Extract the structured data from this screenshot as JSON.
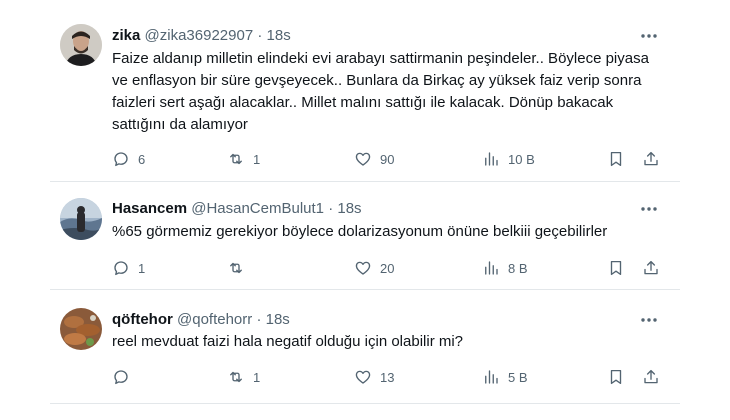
{
  "tweets": [
    {
      "display_name": "zika",
      "handle": "@zika36922907",
      "separator": "·",
      "time": "18s",
      "text": "Faize aldanıp milletin elindeki evi arabayı sattirmanin peşindeler.. Böylece piyasa ve enflasyon bir süre gevşeyecek.. Bunlara da Birkaç ay yüksek faiz verip sonra faizleri sert aşağı alacaklar.. Millet malını sattığı ile kalacak. Dönüp bakacak sattığını da alamıyor",
      "replies": "6",
      "retweets": "1",
      "likes": "90",
      "views": "10 B",
      "avatar_icon": "user-photo-avatar"
    },
    {
      "display_name": "Hasancem",
      "handle": "@HasanCemBulut1",
      "separator": "·",
      "time": "18s",
      "text": "%65 görmemiz gerekiyor böylece dolarizasyonum önüne belkiii geçebilirler",
      "replies": "1",
      "retweets": "",
      "likes": "20",
      "views": "8 B",
      "avatar_icon": "landscape-photo-avatar"
    },
    {
      "display_name": "qöftehor",
      "handle": "@qoftehorr",
      "separator": "·",
      "time": "18s",
      "text": "reel mevduat faizi hala negatif olduğu için olabilir mi?",
      "replies": "",
      "retweets": "1",
      "likes": "13",
      "views": "5 B",
      "avatar_icon": "food-photo-avatar"
    }
  ],
  "icons": {
    "reply": "reply-icon",
    "retweet": "retweet-icon",
    "like": "heart-icon",
    "views": "views-chart-icon",
    "bookmark": "bookmark-icon",
    "share": "share-icon",
    "more": "more-dots-icon"
  },
  "colors": {
    "text": "#0f1419",
    "muted": "#536471",
    "divider": "#e3e7ea"
  }
}
